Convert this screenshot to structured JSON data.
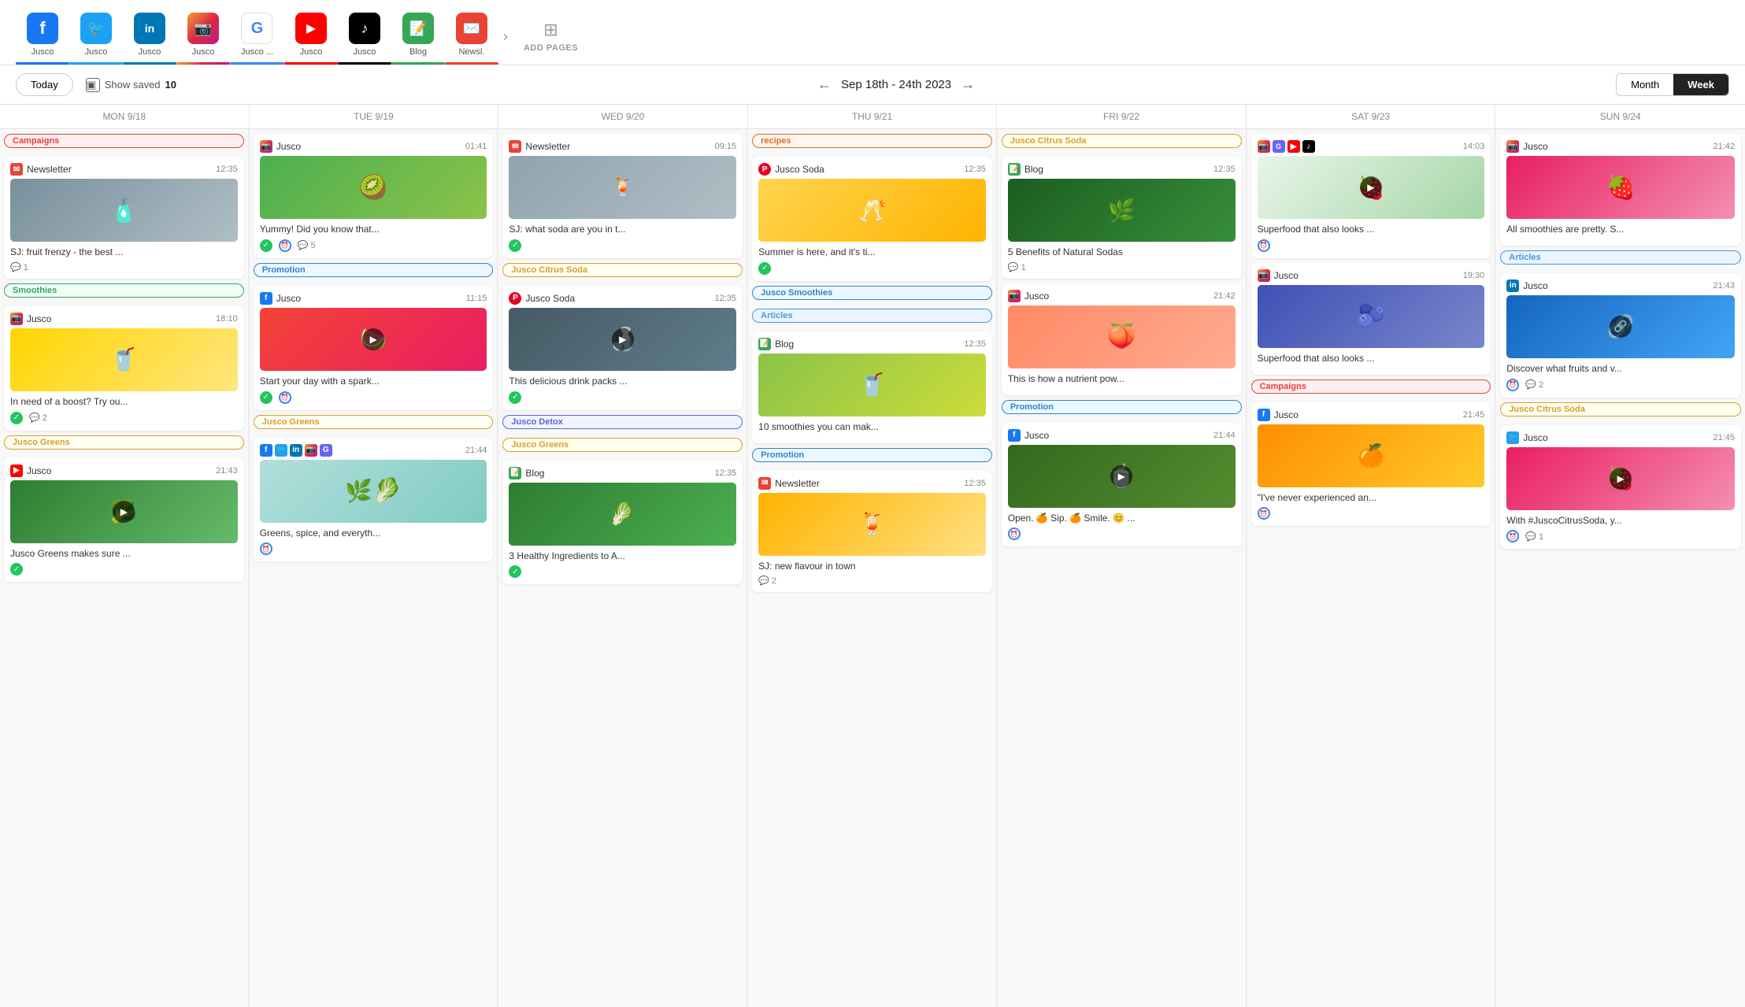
{
  "nav": {
    "items": [
      {
        "id": "fb",
        "label": "Jusco",
        "icon": "f",
        "color": "#1877f2",
        "accent": "#1877f2",
        "emoji": "📘"
      },
      {
        "id": "tw",
        "label": "Jusco",
        "icon": "t",
        "color": "#1da1f2",
        "accent": "#1da1f2",
        "emoji": "🐦"
      },
      {
        "id": "li",
        "label": "Jusco",
        "icon": "in",
        "color": "#0077b5",
        "accent": "#0077b5",
        "emoji": "💼"
      },
      {
        "id": "ig",
        "label": "Jusco",
        "icon": "ig",
        "color": "#e1306c",
        "accent": "#e1306c",
        "emoji": "📷"
      },
      {
        "id": "g",
        "label": "Jusco ...",
        "icon": "G",
        "color": "#4285f4",
        "accent": "#4285f4",
        "emoji": "🔵"
      },
      {
        "id": "yt",
        "label": "Jusco",
        "icon": "▶",
        "color": "#ff0000",
        "accent": "#ff0000",
        "emoji": "▶️"
      },
      {
        "id": "tk",
        "label": "Jusco",
        "icon": "♪",
        "color": "#000",
        "accent": "#000",
        "emoji": "🎵"
      },
      {
        "id": "blog",
        "label": "Blog",
        "icon": "B",
        "color": "#34a853",
        "accent": "#34a853",
        "emoji": "📝"
      },
      {
        "id": "news",
        "label": "Newsl.",
        "icon": "N",
        "color": "#ea4335",
        "accent": "#ea4335",
        "emoji": "✉️"
      }
    ],
    "add_pages_label": "ADD PAGES"
  },
  "toolbar": {
    "today_label": "Today",
    "show_saved_label": "Show saved",
    "show_saved_count": "10",
    "date_range": "Sep 18th - 24th 2023",
    "view_month": "Month",
    "view_week": "Week"
  },
  "calendar": {
    "days": [
      {
        "label": "MON 9/18"
      },
      {
        "label": "TUE 9/19"
      },
      {
        "label": "WED 9/20"
      },
      {
        "label": "THU 9/21"
      },
      {
        "label": "FRI 9/22"
      },
      {
        "label": "SAT 9/23"
      },
      {
        "label": "SUN 9/24"
      }
    ]
  },
  "colors": {
    "accent_blue": "#3b82f6",
    "accent_green": "#22c55e",
    "accent_red": "#ef4444"
  }
}
